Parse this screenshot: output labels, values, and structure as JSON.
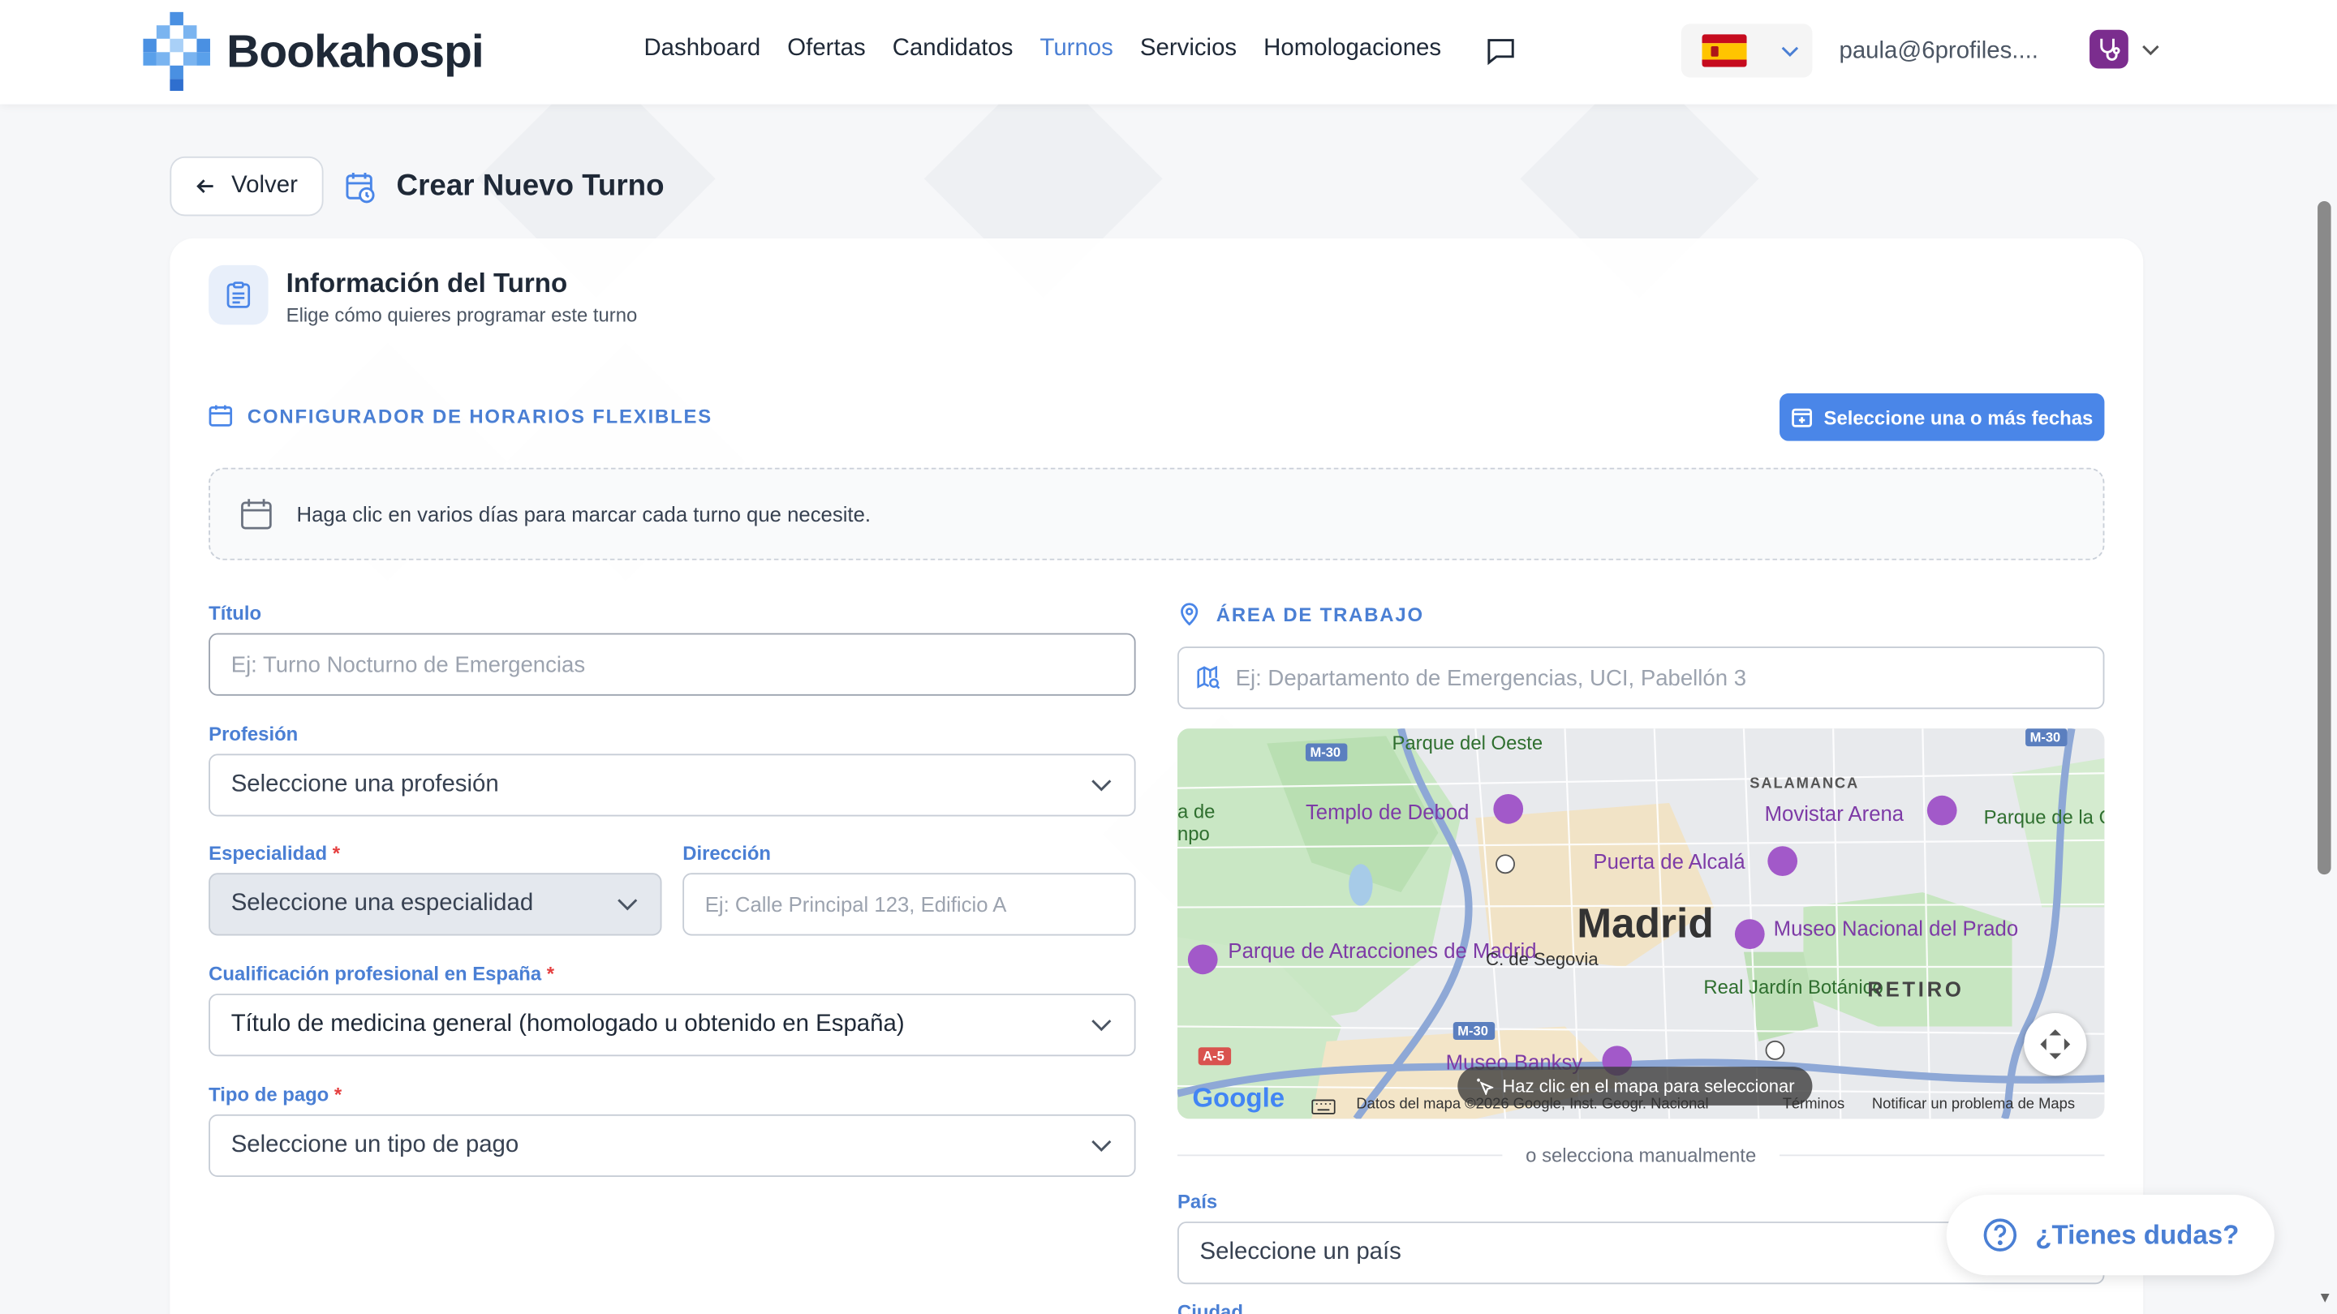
{
  "brand": {
    "name": "Bookahospi"
  },
  "nav": {
    "items": [
      {
        "label": "Dashboard",
        "active": false
      },
      {
        "label": "Ofertas",
        "active": false
      },
      {
        "label": "Candidatos",
        "active": false
      },
      {
        "label": "Turnos",
        "active": true
      },
      {
        "label": "Servicios",
        "active": false
      },
      {
        "label": "Homologaciones",
        "active": false
      }
    ],
    "chat_icon": "message-square-icon"
  },
  "header": {
    "language_flag": "spain-flag",
    "user_email": "paula@6profiles...."
  },
  "page": {
    "back_label": "Volver",
    "title": "Crear Nuevo Turno"
  },
  "info": {
    "title": "Información del Turno",
    "subtitle": "Elige cómo quieres programar este turno"
  },
  "schedule": {
    "section_label": "CONFIGURADOR DE HORARIOS FLEXIBLES",
    "dates_button": "Seleccione una o más fechas",
    "hint": "Haga clic en varios días para marcar cada turno que necesite."
  },
  "form": {
    "titulo": {
      "label": "Título",
      "placeholder": "Ej: Turno Nocturno de Emergencias"
    },
    "profesion": {
      "label": "Profesión",
      "value": "Seleccione una profesión"
    },
    "especialidad": {
      "label": "Especialidad",
      "required": "*",
      "value": "Seleccione una especialidad"
    },
    "direccion": {
      "label": "Dirección",
      "placeholder": "Ej: Calle Principal 123, Edificio A"
    },
    "cualificacion": {
      "label": "Cualificación profesional en España",
      "required": "*",
      "value": "Título de medicina general (homologado u obtenido en España)"
    },
    "tipo_pago": {
      "label": "Tipo de pago",
      "required": "*",
      "value": "Seleccione un tipo de pago"
    }
  },
  "work_area": {
    "section_label": "ÁREA DE TRABAJO",
    "placeholder": "Ej: Departamento de Emergencias, UCI, Pabellón 3",
    "map": {
      "city": "Madrid",
      "labels": {
        "parque_oeste": "Parque del Oeste",
        "templo": "Templo de Debod",
        "salamanca": "SALAMANCA",
        "movistar": "Movistar Arena",
        "quinta": "Parque de la Quinta de la Fuente del Berro",
        "alcala": "Puerta de Alcalá",
        "atracciones": "Parque de Atracciones de Madrid",
        "segovia": "C. de Segovia",
        "prado": "Museo Nacional del Prado",
        "jardin": "Real Jardín Botánico",
        "retiro": "RETIRO",
        "banksy": "Museo Banksy",
        "ade": "a de",
        "npo": "npo",
        "m30a": "M-30",
        "m30b": "M-30",
        "m30c": "M-30",
        "a5": "A-5",
        "google": "Google"
      },
      "hint": "Haz clic en el mapa para seleccionar",
      "footer_data": "Datos del mapa ©2026 Google, Inst. Geogr. Nacional",
      "footer_terms": "Términos",
      "footer_report": "Notificar un problema de Maps"
    },
    "manual_divider": "o selecciona manualmente",
    "pais": {
      "label": "País",
      "value": "Seleccione un país"
    },
    "ciudad": {
      "label": "Ciudad"
    }
  },
  "help": {
    "label": "¿Tienes dudas?"
  },
  "colors": {
    "accent": "#4a7fd4",
    "button": "#4a86e8",
    "required": "#e53e3e",
    "brand_purple": "#7b2d8e"
  }
}
